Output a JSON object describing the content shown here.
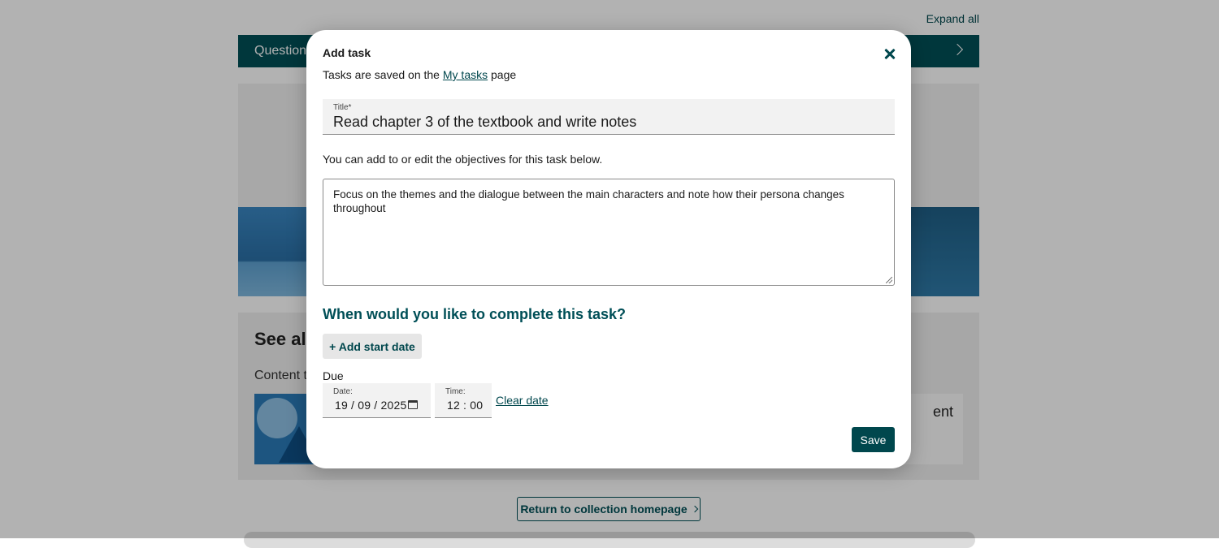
{
  "background": {
    "expand_all": "Expand all",
    "question_bar_label": "Question",
    "see_also_heading": "See als",
    "content_text": "Content t",
    "card_right_text": "ent",
    "return_button": "Return to collection homepage"
  },
  "modal": {
    "title": "Add task",
    "subtitle_prefix": "Tasks are saved on the",
    "subtitle_link": "My tasks",
    "subtitle_suffix": "page",
    "title_field": {
      "label": "Title*",
      "value": "Read chapter 3 of the textbook and write notes"
    },
    "objectives_help": "You can add to or edit the objectives for this task below.",
    "objectives_value": "Focus on the themes and the dialogue between the main characters and note how their persona changes throughout",
    "when_heading": "When would you like to complete this task?",
    "add_start_date": "+ Add start date",
    "due_label": "Due",
    "date_field": {
      "label": "Date:",
      "value": "19 / 09 / 2025"
    },
    "time_field": {
      "label": "Time:",
      "value": "12 : 00"
    },
    "clear_date": "Clear date",
    "save": "Save"
  },
  "colors": {
    "accent": "#00474d",
    "overlay": "rgba(0,0,0,0.30)"
  }
}
